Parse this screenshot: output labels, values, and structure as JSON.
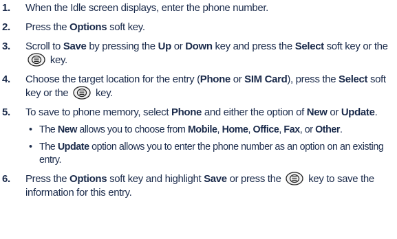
{
  "steps": [
    {
      "num": "1.",
      "segments": [
        {
          "t": "When the Idle screen displays, enter the phone number."
        }
      ]
    },
    {
      "num": "2.",
      "segments": [
        {
          "t": "Press the "
        },
        {
          "t": "Options",
          "b": true
        },
        {
          "t": " soft key."
        }
      ]
    },
    {
      "num": "3.",
      "segments": [
        {
          "t": "Scroll to "
        },
        {
          "t": "Save",
          "b": true
        },
        {
          "t": " by pressing the "
        },
        {
          "t": "Up",
          "b": true
        },
        {
          "t": " or "
        },
        {
          "t": "Down",
          "b": true
        },
        {
          "t": " key and press the "
        },
        {
          "t": "Select",
          "b": true
        },
        {
          "t": " soft key or the "
        },
        {
          "icon": "menu-ok-key-icon"
        },
        {
          "t": " key."
        }
      ]
    },
    {
      "num": "4.",
      "segments": [
        {
          "t": "Choose the target location for the entry ("
        },
        {
          "t": "Phone",
          "b": true
        },
        {
          "t": " or "
        },
        {
          "t": "SIM Card",
          "b": true
        },
        {
          "t": "), press the "
        },
        {
          "t": "Select",
          "b": true
        },
        {
          "t": " soft key or the "
        },
        {
          "icon": "menu-ok-key-icon"
        },
        {
          "t": " key."
        }
      ]
    },
    {
      "num": "5.",
      "segments": [
        {
          "t": "To save to phone memory, select "
        },
        {
          "t": "Phone",
          "b": true
        },
        {
          "t": " and either the option of "
        },
        {
          "t": "New",
          "b": true
        },
        {
          "t": " or "
        },
        {
          "t": "Update",
          "b": true
        },
        {
          "t": "."
        }
      ],
      "bullets": [
        {
          "segments": [
            {
              "t": "The "
            },
            {
              "t": "New",
              "b": true
            },
            {
              "t": " allows you to choose from "
            },
            {
              "t": "Mobile",
              "b": true
            },
            {
              "t": ", "
            },
            {
              "t": "Home",
              "b": true
            },
            {
              "t": ", "
            },
            {
              "t": "Office",
              "b": true
            },
            {
              "t": ", "
            },
            {
              "t": "Fax",
              "b": true
            },
            {
              "t": ", or "
            },
            {
              "t": "Other",
              "b": true
            },
            {
              "t": "."
            }
          ]
        },
        {
          "segments": [
            {
              "t": "The "
            },
            {
              "t": "Update",
              "b": true
            },
            {
              "t": " option allows you to enter the phone number as an option on an existing entry."
            }
          ]
        }
      ]
    },
    {
      "num": "6.",
      "segments": [
        {
          "t": "Press the "
        },
        {
          "t": "Options",
          "b": true
        },
        {
          "t": " soft key and highlight "
        },
        {
          "t": "Save",
          "b": true
        },
        {
          "t": " or press the "
        },
        {
          "icon": "menu-ok-key-icon"
        },
        {
          "t": " key to save the information for this entry."
        }
      ]
    }
  ],
  "bullet_char": "•",
  "colors": {
    "text": "#1a2a4a",
    "icon_fill": "#f2f2f2",
    "icon_stroke": "#222222"
  }
}
